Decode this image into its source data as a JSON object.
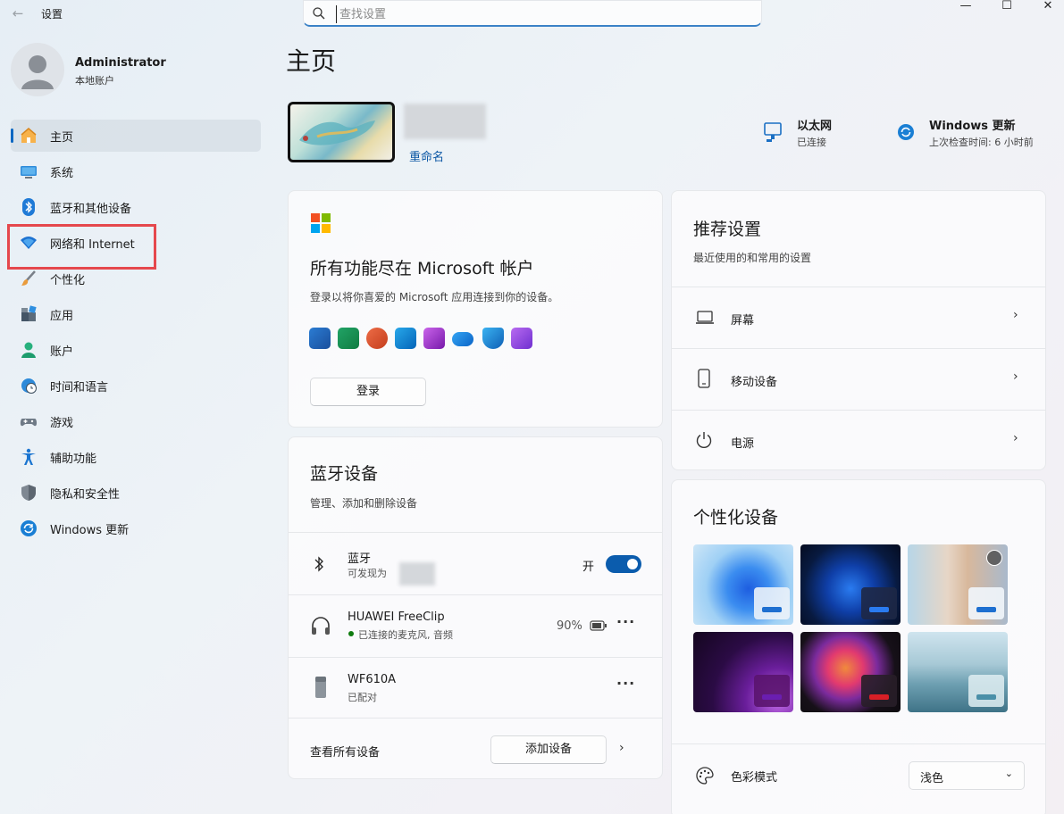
{
  "titlebar": {
    "app_title": "设置",
    "back_icon": "arrow-left-icon"
  },
  "search": {
    "placeholder": "查找设置"
  },
  "user": {
    "name": "Administrator",
    "type": "本地账户"
  },
  "nav": {
    "items": [
      {
        "label": "主页",
        "icon": "home-icon"
      },
      {
        "label": "系统",
        "icon": "system-icon"
      },
      {
        "label": "蓝牙和其他设备",
        "icon": "bluetooth-icon"
      },
      {
        "label": "网络和 Internet",
        "icon": "wifi-icon"
      },
      {
        "label": "个性化",
        "icon": "brush-icon"
      },
      {
        "label": "应用",
        "icon": "apps-icon"
      },
      {
        "label": "账户",
        "icon": "person-icon"
      },
      {
        "label": "时间和语言",
        "icon": "globe-clock-icon"
      },
      {
        "label": "游戏",
        "icon": "gamepad-icon"
      },
      {
        "label": "辅助功能",
        "icon": "accessibility-icon"
      },
      {
        "label": "隐私和安全性",
        "icon": "shield-icon"
      },
      {
        "label": "Windows 更新",
        "icon": "update-icon"
      }
    ],
    "active_index": 0,
    "highlighted_index": 3
  },
  "main": {
    "title": "主页",
    "device": {
      "rename": "重命名"
    },
    "status": {
      "ethernet": {
        "label": "以太网",
        "sub": "已连接"
      },
      "update": {
        "label": "Windows 更新",
        "sub": "上次检查时间: 6 小时前"
      }
    }
  },
  "ms_card": {
    "title": "所有功能尽在 Microsoft 帐户",
    "sub": "登录以将你喜爱的 Microsoft 应用连接到你的设备。",
    "button": "登录",
    "apps": [
      "word-icon",
      "excel-icon",
      "powerpoint-icon",
      "outlook-icon",
      "onenote-icon",
      "onedrive-icon",
      "defender-icon",
      "clipchamp-icon"
    ]
  },
  "bt_card": {
    "title": "蓝牙设备",
    "sub": "管理、添加和删除设备",
    "bluetooth": {
      "name": "蓝牙",
      "sub": "可发现为",
      "toggle_label": "开"
    },
    "devices": [
      {
        "name": "HUAWEI FreeClip",
        "status": "已连接的麦克风, 音频",
        "battery": "90%",
        "status_color": "#0f7b0f"
      },
      {
        "name": "WF610A",
        "status": "已配对"
      }
    ],
    "see_all": "查看所有设备",
    "add_button": "添加设备"
  },
  "rec_card": {
    "title": "推荐设置",
    "sub": "最近使用的和常用的设置",
    "items": [
      {
        "label": "屏幕",
        "icon": "laptop-icon"
      },
      {
        "label": "移动设备",
        "icon": "phone-icon"
      },
      {
        "label": "电源",
        "icon": "power-icon"
      }
    ]
  },
  "pers_card": {
    "title": "个性化设备",
    "color_mode_label": "色彩模式",
    "color_mode_value": "浅色"
  }
}
